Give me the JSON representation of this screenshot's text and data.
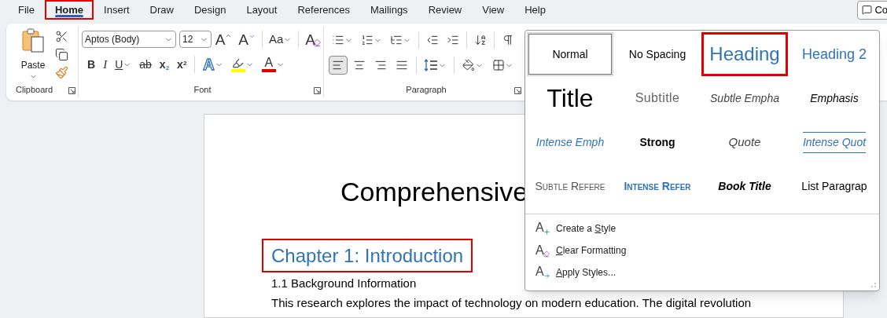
{
  "menu_tabs": [
    {
      "label": "File",
      "selected": false,
      "highlighted": false
    },
    {
      "label": "Home",
      "selected": true,
      "highlighted": true
    },
    {
      "label": "Insert",
      "selected": false,
      "highlighted": false
    },
    {
      "label": "Draw",
      "selected": false,
      "highlighted": false
    },
    {
      "label": "Design",
      "selected": false,
      "highlighted": false
    },
    {
      "label": "Layout",
      "selected": false,
      "highlighted": false
    },
    {
      "label": "References",
      "selected": false,
      "highlighted": false
    },
    {
      "label": "Mailings",
      "selected": false,
      "highlighted": false
    },
    {
      "label": "Review",
      "selected": false,
      "highlighted": false
    },
    {
      "label": "View",
      "selected": false,
      "highlighted": false
    },
    {
      "label": "Help",
      "selected": false,
      "highlighted": false
    }
  ],
  "comments_button": {
    "label": "Co"
  },
  "ribbon": {
    "clipboard": {
      "paste_label": "Paste",
      "group_label": "Clipboard"
    },
    "font": {
      "font_name": "Aptos (Body)",
      "font_size": "12",
      "group_label": "Font",
      "row1": [
        {
          "kind": "grow",
          "label": "A"
        },
        {
          "kind": "shrink",
          "label": "A"
        },
        {
          "kind": "case",
          "label": "Aa"
        },
        {
          "kind": "clear",
          "label": "A"
        }
      ],
      "row2": [
        {
          "kind": "bold",
          "label": "B"
        },
        {
          "kind": "italic",
          "label": "I"
        },
        {
          "kind": "underline",
          "label": "U"
        },
        {
          "kind": "strike",
          "label": "ab"
        },
        {
          "kind": "subscript",
          "label": "x",
          "mark": "2"
        },
        {
          "kind": "superscript",
          "label": "x",
          "mark": "2"
        },
        {
          "kind": "effects",
          "label": "A"
        },
        {
          "kind": "highlight"
        },
        {
          "kind": "color",
          "label": "A"
        }
      ]
    },
    "paragraph": {
      "group_label": "Paragraph",
      "alignments": [
        {
          "kind": "left",
          "selected": true
        },
        {
          "kind": "center",
          "selected": false
        },
        {
          "kind": "right",
          "selected": false
        },
        {
          "kind": "justify",
          "selected": false
        }
      ]
    }
  },
  "styles_gallery": {
    "styles": [
      {
        "label": "Normal",
        "kind": "normal",
        "selected": true,
        "highlighted": false
      },
      {
        "label": "No Spacing",
        "kind": "normal",
        "selected": false,
        "highlighted": false
      },
      {
        "label": "Heading",
        "kind": "heading1",
        "selected": false,
        "highlighted": true
      },
      {
        "label": "Heading 2",
        "kind": "heading2",
        "selected": false,
        "highlighted": false
      },
      {
        "label": "Title",
        "kind": "title",
        "selected": false,
        "highlighted": false
      },
      {
        "label": "Subtitle",
        "kind": "subtitle",
        "selected": false,
        "highlighted": false
      },
      {
        "label": "Subtle Empha",
        "kind": "subtle-emphasis",
        "selected": false,
        "highlighted": false
      },
      {
        "label": "Emphasis",
        "kind": "emphasis",
        "selected": false,
        "highlighted": false
      },
      {
        "label": "Intense Emph",
        "kind": "intense-emphasis",
        "selected": false,
        "highlighted": false
      },
      {
        "label": "Strong",
        "kind": "strong",
        "selected": false,
        "highlighted": false
      },
      {
        "label": "Quote",
        "kind": "quote",
        "selected": false,
        "highlighted": false
      },
      {
        "label": "Intense Quot",
        "kind": "intense-quote",
        "selected": false,
        "highlighted": false
      },
      {
        "label": "Subtle Refere",
        "kind": "subtle-reference",
        "selected": false,
        "highlighted": false
      },
      {
        "label": "Intense Refer",
        "kind": "intense-reference",
        "selected": false,
        "highlighted": false
      },
      {
        "label": "Book Title",
        "kind": "book-title",
        "selected": false,
        "highlighted": false
      },
      {
        "label": "List Paragrap",
        "kind": "list-paragraph",
        "selected": false,
        "highlighted": false
      }
    ],
    "commands": [
      {
        "kind": "create",
        "glyph": "A",
        "before": "Create a ",
        "key": "S",
        "after": "tyle"
      },
      {
        "kind": "clear",
        "glyph": "A",
        "key": "C",
        "after": "lear Formatting"
      },
      {
        "kind": "apply",
        "glyph": "A",
        "key": "A",
        "after": "pply Styles..."
      }
    ]
  },
  "document": {
    "title": "Comprehensive",
    "heading": {
      "text": "Chapter 1: Introduction",
      "highlighted": true
    },
    "subheading": "1.1 Background Information",
    "paragraph": "This research explores the impact of technology on modern education. The digital revolution"
  }
}
